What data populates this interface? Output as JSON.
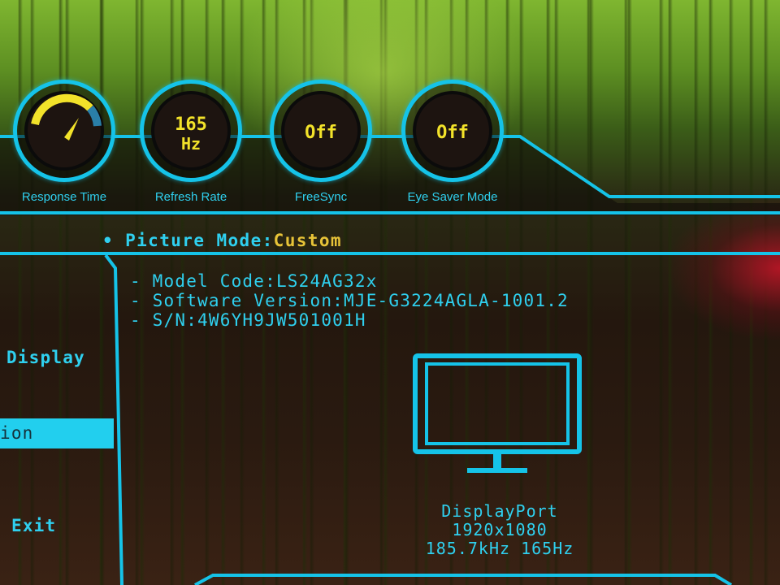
{
  "colors": {
    "accent": "#15c3e8",
    "value": "#f2e22a",
    "picture_mode_value": "#e8c338",
    "selected_bg": "#22cfee"
  },
  "gauges": {
    "response_time": {
      "label": "Response Time",
      "level": 0.7,
      "icon": "dial-gauge-icon"
    },
    "refresh_rate": {
      "label": "Refresh Rate",
      "value_top": "165",
      "value_bottom": "Hz"
    },
    "freesync": {
      "label": "FreeSync",
      "value": "Off"
    },
    "eye_saver": {
      "label": "Eye Saver Mode",
      "value": "Off"
    }
  },
  "picture_mode": {
    "bullet": "•",
    "label": "Picture Mode:",
    "value": "Custom"
  },
  "info": {
    "model_code": "- Model Code:LS24AG32x",
    "software_version": "- Software Version:MJE-G3224AGLA-1001.2",
    "serial": "- S/N:4W6YH9JW501001H"
  },
  "menu": {
    "display": "Display",
    "selected": "ion",
    "exit": "Exit"
  },
  "source": {
    "icon": "monitor-icon",
    "port": "DisplayPort",
    "resolution": "1920x1080",
    "frequency": "185.7kHz 165Hz"
  }
}
